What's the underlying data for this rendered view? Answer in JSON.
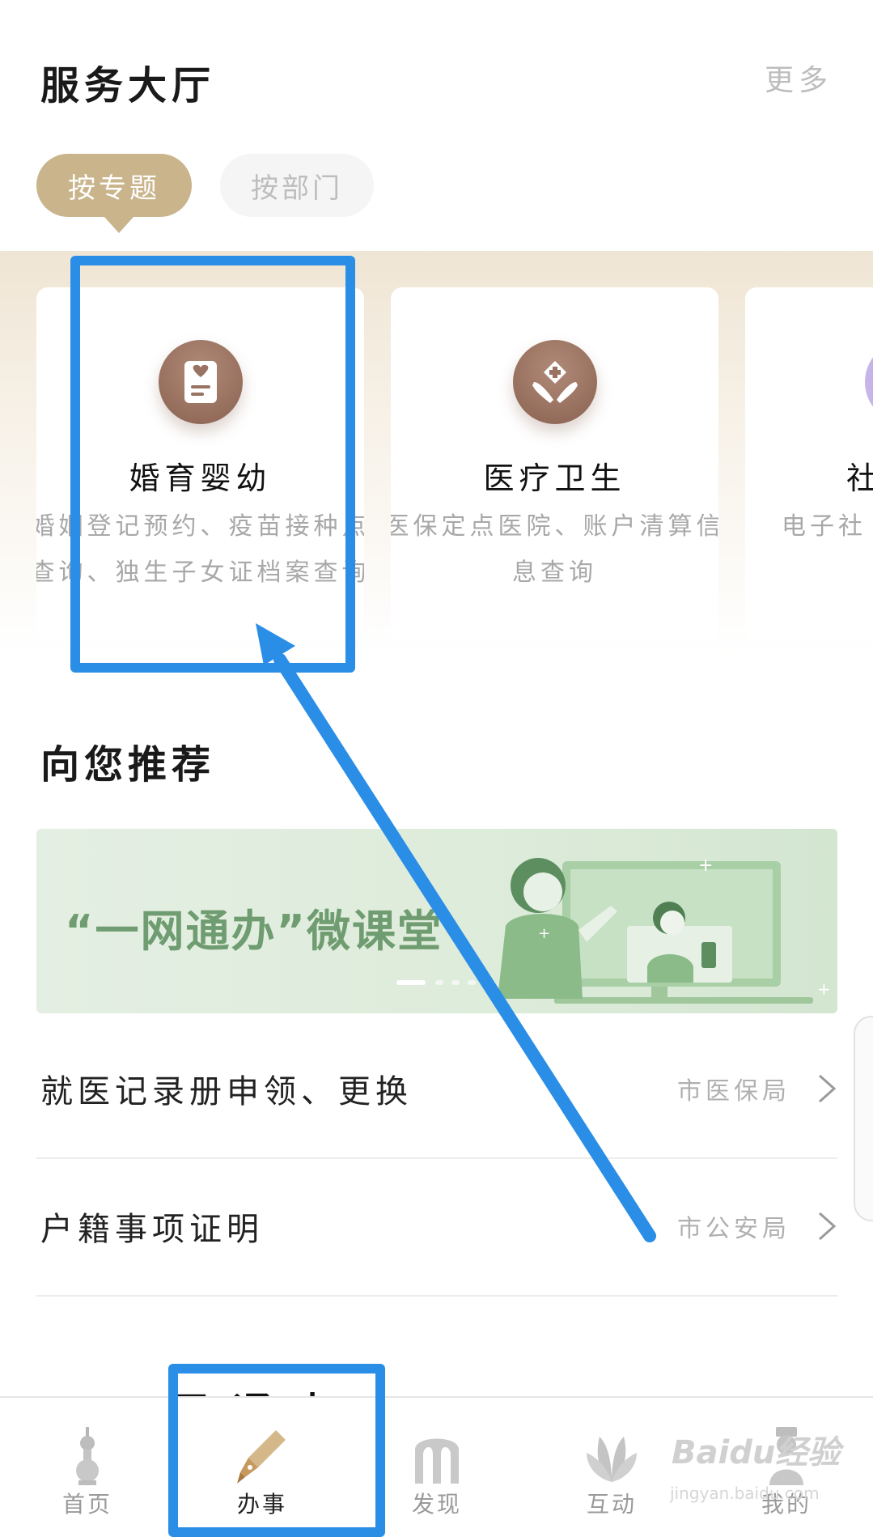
{
  "header": {
    "title": "服务大厅",
    "more_label": "更多"
  },
  "tabs": {
    "by_topic": "按专题",
    "by_department": "按部门"
  },
  "service_cards": [
    {
      "title": "婚育婴幼",
      "description": "婚姻登记预约、疫苗接种点查询、独生子女证档案查询",
      "icon": "marriage-certificate-icon"
    },
    {
      "title": "医疗卫生",
      "description": "医保定点医院、账户清算信息查询",
      "icon": "medical-cross-hands-icon"
    },
    {
      "title": "社",
      "description": "电子社",
      "icon": "social-icon"
    }
  ],
  "recommend": {
    "title": "向您推荐",
    "banner_text": "“一网通办”微课堂"
  },
  "list_items": [
    {
      "title": "就医记录册申领、更换",
      "department": "市医保局"
    },
    {
      "title": "户籍事项证明",
      "department": "市公安局"
    }
  ],
  "next_section_peek": "“一网通办”",
  "bottom_nav": [
    {
      "label": "首页",
      "icon": "tower-icon"
    },
    {
      "label": "办事",
      "icon": "fountain-pen-icon"
    },
    {
      "label": "发现",
      "icon": "arch-icon"
    },
    {
      "label": "互动",
      "icon": "magnolia-icon"
    },
    {
      "label": "我的",
      "icon": "person-icon"
    }
  ],
  "watermark": {
    "brand": "Baidu经验",
    "url": "jingyan.baidu.com"
  },
  "colors": {
    "accent": "#c9b48c",
    "card_icon": "#9a7262",
    "annotation": "#2a8ee6",
    "banner_text": "#6f9c70"
  }
}
